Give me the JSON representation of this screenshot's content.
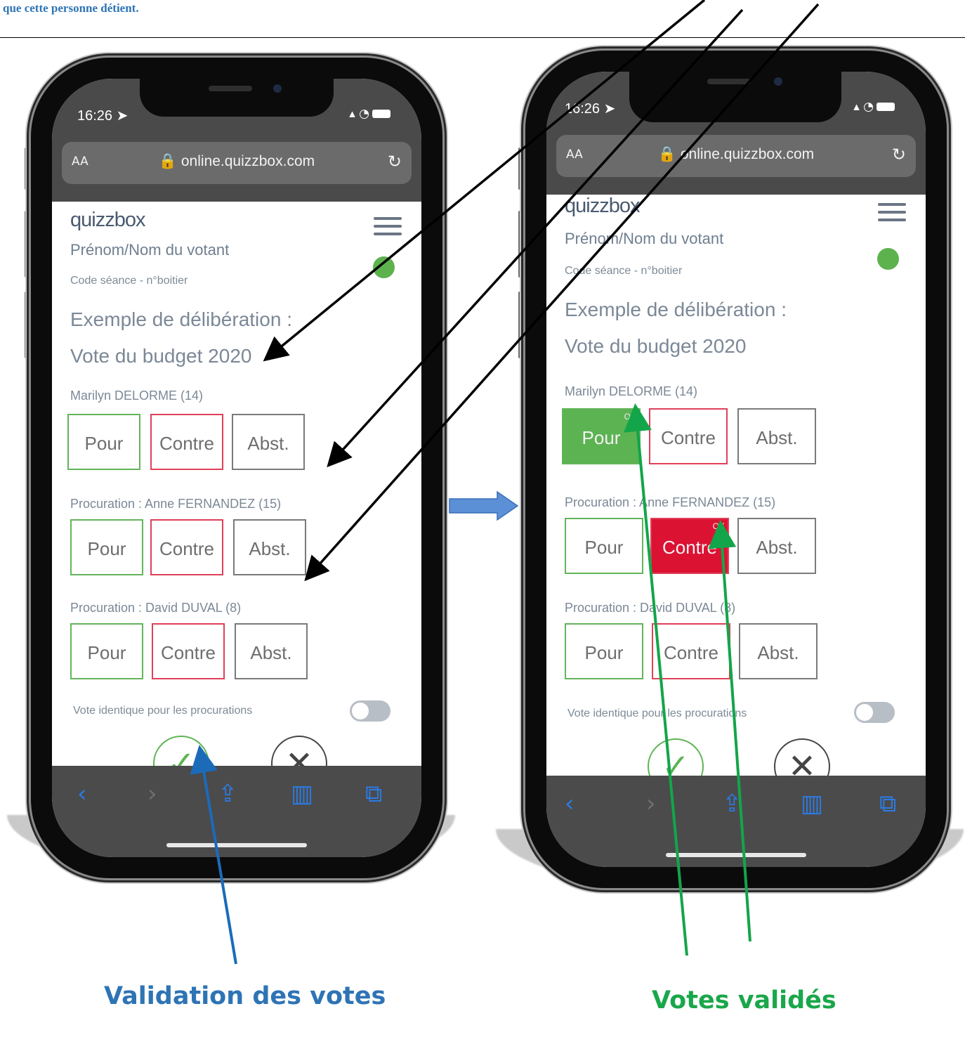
{
  "header_text": "que cette personne détient.",
  "phones": [
    {
      "status_time": "16:26 ➤",
      "url_aa": "AA",
      "url": "🔒 online.quizzbox.com",
      "logo": "quizzbox",
      "voter": "Prénom/Nom du votant",
      "code": "Code séance - n°boitier",
      "question_line1": "Exemple de délibération :",
      "question_line2": "Vote du budget 2020",
      "status_dot_color": "#5db24e",
      "voters": [
        {
          "label": "Marilyn DELORME (14)",
          "pour": "Pour",
          "contre": "Contre",
          "abst": "Abst.",
          "selected": ""
        },
        {
          "label": "Procuration : Anne FERNANDEZ (15)",
          "pour": "Pour",
          "contre": "Contre",
          "abst": "Abst.",
          "selected": ""
        },
        {
          "label": "Procuration : David DUVAL (8)",
          "pour": "Pour",
          "contre": "Contre",
          "abst": "Abst.",
          "selected": ""
        }
      ],
      "toggle_label": "Vote identique pour les procurations",
      "toggle_on": false
    },
    {
      "status_time": "16:26 ➤",
      "url_aa": "AA",
      "url": "🔒 online.quizzbox.com",
      "logo": "quizzbox",
      "voter": "Prénom/Nom du votant",
      "code": "Code séance - n°boitier",
      "question_line1": "Exemple de délibération :",
      "question_line2": "Vote du budget 2020",
      "status_dot_color": "#5db24e",
      "voters": [
        {
          "label": "Marilyn DELORME (14)",
          "pour": "Pour",
          "contre": "Contre",
          "abst": "Abst.",
          "selected": "pour",
          "ok": "OK"
        },
        {
          "label": "Procuration : Anne FERNANDEZ (15)",
          "pour": "Pour",
          "contre": "Contre",
          "abst": "Abst.",
          "selected": "contre",
          "ok": "OK"
        },
        {
          "label": "Procuration : David DUVAL (8)",
          "pour": "Pour",
          "contre": "Contre",
          "abst": "Abst.",
          "selected": ""
        }
      ],
      "toggle_label": "Vote identique pour les procurations",
      "toggle_on": false
    }
  ],
  "caption_left": "Validation des votes",
  "caption_right": "Votes validés",
  "colors": {
    "caption_left": "#2e74b5",
    "caption_right": "#1aa74a",
    "pour_green": "#5cb352",
    "contre_red": "#dc1233",
    "arrow_black": "#000000",
    "arrow_blue": "#1b6bb8",
    "arrow_green": "#13a54a",
    "block_arrow": "#5b8fd6"
  },
  "icons": {
    "check": "checkmark-icon",
    "cancel": "close-icon",
    "back": "back-chevron-icon",
    "forward": "forward-chevron-icon",
    "share": "share-icon",
    "bookmarks": "book-icon",
    "tabs": "tabs-icon",
    "reload": "reload-icon",
    "lock": "lock-icon"
  }
}
